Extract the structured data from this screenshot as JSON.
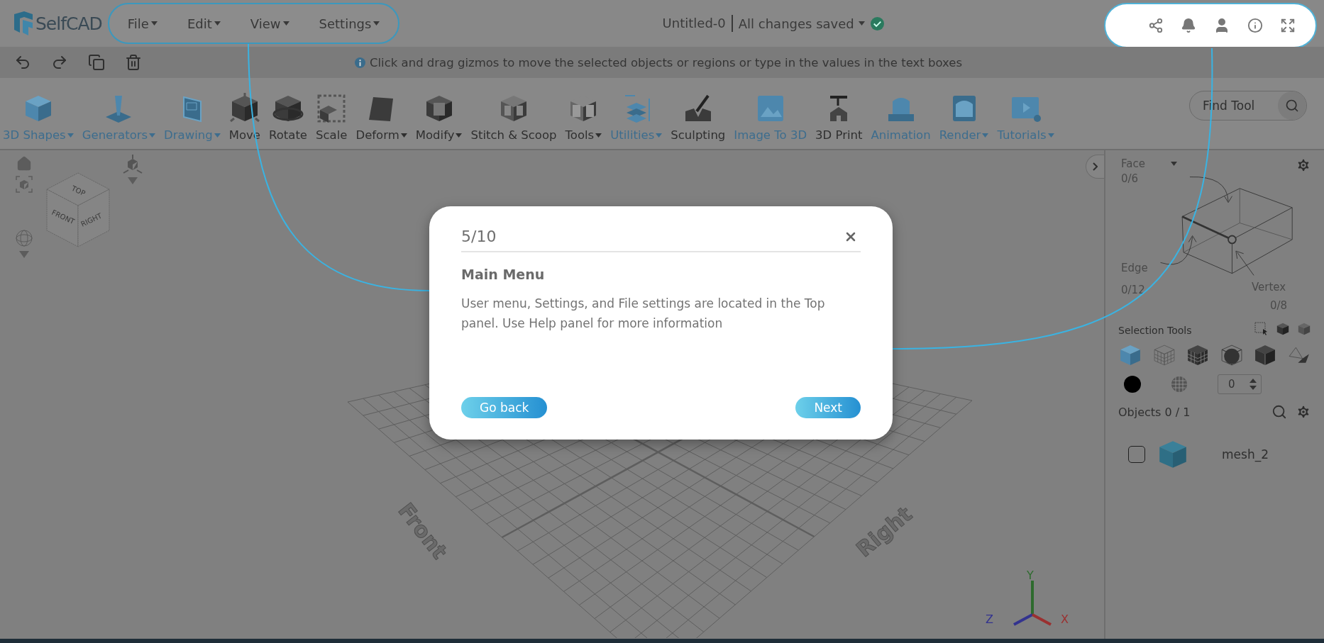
{
  "app": {
    "logo": "SelfCAD"
  },
  "main_menu": [
    {
      "label": "File"
    },
    {
      "label": "Edit"
    },
    {
      "label": "View"
    },
    {
      "label": "Settings"
    }
  ],
  "document": {
    "title": "Untitled-0",
    "status": "All changes saved",
    "saved": true
  },
  "hint": "Click and drag gizmos to move the selected objects or regions or type in the values in the text boxes",
  "tools": [
    {
      "label": "3D Shapes",
      "accent": true,
      "dropdown": true
    },
    {
      "label": "Generators",
      "accent": true,
      "dropdown": true
    },
    {
      "label": "Drawing",
      "accent": true,
      "dropdown": true
    },
    {
      "label": "Move",
      "accent": false,
      "dropdown": false
    },
    {
      "label": "Rotate",
      "accent": false,
      "dropdown": false
    },
    {
      "label": "Scale",
      "accent": false,
      "dropdown": false
    },
    {
      "label": "Deform",
      "accent": false,
      "dropdown": true
    },
    {
      "label": "Modify",
      "accent": false,
      "dropdown": true
    },
    {
      "label": "Stitch & Scoop",
      "accent": false,
      "dropdown": false
    },
    {
      "label": "Tools",
      "accent": false,
      "dropdown": true
    },
    {
      "label": "Utilities",
      "accent": true,
      "dropdown": true
    },
    {
      "label": "Sculpting",
      "accent": false,
      "dropdown": false
    },
    {
      "label": "Image To 3D",
      "accent": true,
      "dropdown": false
    },
    {
      "label": "3D Print",
      "accent": false,
      "dropdown": false
    },
    {
      "label": "Animation",
      "accent": true,
      "dropdown": false
    },
    {
      "label": "Render",
      "accent": true,
      "dropdown": true
    },
    {
      "label": "Tutorials",
      "accent": true,
      "dropdown": true
    }
  ],
  "find_tool": {
    "placeholder": "Find Tool"
  },
  "view_cube": {
    "faces": [
      "TOP",
      "FRONT",
      "RIGHT"
    ]
  },
  "scene": {
    "labels": [
      "Front",
      "Right"
    ],
    "axes": [
      "Y",
      "Z",
      "X"
    ]
  },
  "selection_panel": {
    "mode": "Face",
    "face_count": "0/6",
    "edge_label": "Edge",
    "edge_count": "0/12",
    "vertex_label": "Vertex",
    "vertex_count": "0/8",
    "tools_label": "Selection Tools",
    "spinner_value": "0",
    "objects_label": "Objects 0 / 1",
    "objects": [
      {
        "name": "mesh_2",
        "checked": false
      }
    ]
  },
  "tour": {
    "step": "5/10",
    "title": "Main Menu",
    "body": "User menu, Settings, and File settings are located in the Top panel. Use Help panel for more information",
    "buttons": [
      "Go back",
      "Next"
    ]
  }
}
